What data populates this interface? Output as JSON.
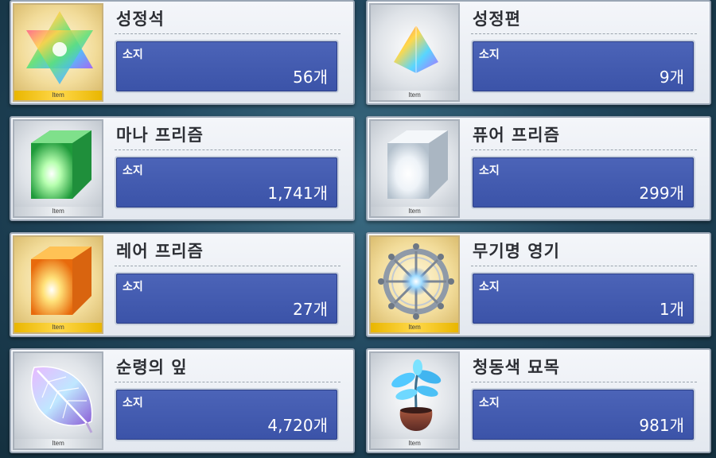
{
  "items": [
    {
      "name": "성정석",
      "owned_label": "소지",
      "count": "56개",
      "rarity": "Item",
      "frame": "gold",
      "icon": "saint-quartz-icon"
    },
    {
      "name": "성정편",
      "owned_label": "소지",
      "count": "9개",
      "rarity": "Item",
      "frame": "silver",
      "icon": "quartz-fragment-icon"
    },
    {
      "name": "마나 프리즘",
      "owned_label": "소지",
      "count": "1,741개",
      "rarity": "Item",
      "frame": "silver",
      "icon": "mana-prism-icon"
    },
    {
      "name": "퓨어 프리즘",
      "owned_label": "소지",
      "count": "299개",
      "rarity": "Item",
      "frame": "silver",
      "icon": "pure-prism-icon"
    },
    {
      "name": "레어 프리즘",
      "owned_label": "소지",
      "count": "27개",
      "rarity": "Item",
      "frame": "gold",
      "icon": "rare-prism-icon"
    },
    {
      "name": "무기명 영기",
      "owned_label": "소지",
      "count": "1개",
      "rarity": "Item",
      "frame": "gold",
      "icon": "unregistered-spirit-origin-icon"
    },
    {
      "name": "순령의 잎",
      "owned_label": "소지",
      "count": "4,720개",
      "rarity": "Item",
      "frame": "silver",
      "icon": "pure-spirit-leaf-icon"
    },
    {
      "name": "청동색 묘목",
      "owned_label": "소지",
      "count": "981개",
      "rarity": "Item",
      "frame": "silver",
      "icon": "bronze-sapling-icon"
    }
  ]
}
